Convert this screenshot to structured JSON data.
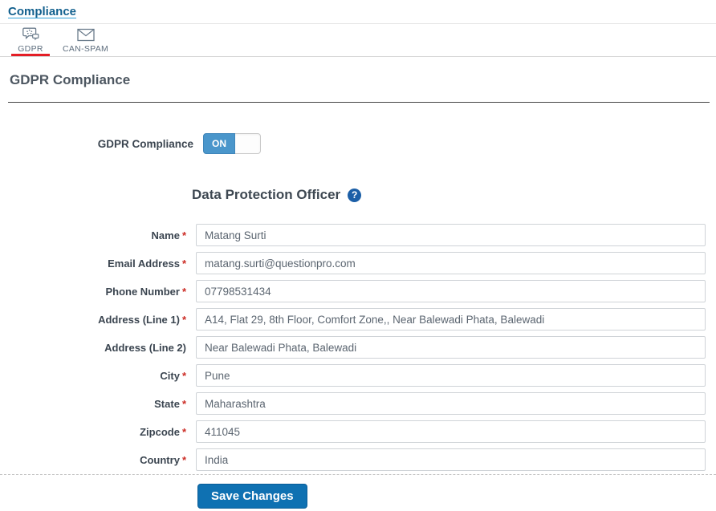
{
  "breadcrumb": {
    "label": "Compliance"
  },
  "tabs": {
    "items": [
      {
        "label": "GDPR",
        "icon": "gdpr-chat-icon",
        "active": true
      },
      {
        "label": "CAN-SPAM",
        "icon": "envelope-icon",
        "active": false
      }
    ]
  },
  "page": {
    "title": "GDPR Compliance"
  },
  "toggle": {
    "label": "GDPR Compliance",
    "state": "ON"
  },
  "section": {
    "title": "Data Protection Officer",
    "help_icon": "question-circle-icon",
    "help_glyph": "?"
  },
  "form": {
    "required_marker": "*",
    "fields": [
      {
        "label": "Name",
        "required": true,
        "value": "Matang Surti"
      },
      {
        "label": "Email Address",
        "required": true,
        "value": "matang.surti@questionpro.com"
      },
      {
        "label": "Phone Number",
        "required": true,
        "value": "07798531434"
      },
      {
        "label": "Address (Line 1)",
        "required": true,
        "value": "A14, Flat 29, 8th Floor, Comfort Zone,, Near Balewadi Phata, Balewadi"
      },
      {
        "label": "Address (Line 2)",
        "required": false,
        "value": "Near Balewadi Phata, Balewadi"
      },
      {
        "label": "City",
        "required": true,
        "value": "Pune"
      },
      {
        "label": "State",
        "required": true,
        "value": "Maharashtra"
      },
      {
        "label": "Zipcode",
        "required": true,
        "value": "411045"
      },
      {
        "label": "Country",
        "required": true,
        "value": "India"
      }
    ],
    "save_label": "Save Changes"
  },
  "colors": {
    "link_blue": "#12608e",
    "link_underline_blue": "#2d9fd8",
    "tab_text_gray": "#5e6e7e",
    "active_tab_red": "#e41e26",
    "heading_slate": "#4d5761",
    "label_dark": "#3b4550",
    "required_red": "#cc2b24",
    "input_border_gray": "#cfd3d7",
    "toggle_blue": "#4a96cb",
    "save_button_blue": "#0f71b2",
    "help_icon_blue": "#1c5fa7"
  }
}
